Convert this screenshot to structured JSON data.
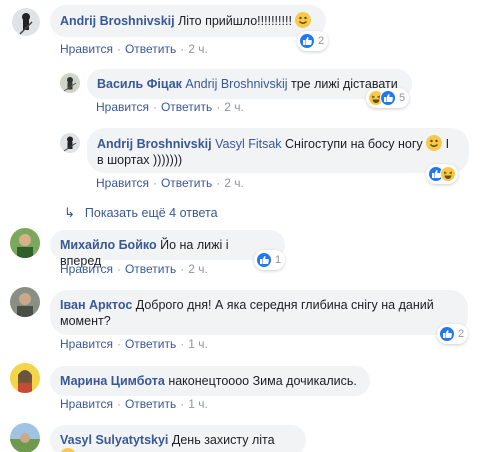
{
  "actions": {
    "like": "Нравится",
    "reply": "Ответить",
    "sep": "·"
  },
  "comments": [
    {
      "author": "Andrij Broshnivskij",
      "text": "Літо прийшло!!!!!!!!!!",
      "time": "2 ч.",
      "reactions": "2"
    },
    {
      "author": "Василь Фіцак",
      "mention": "Andrij Broshnivskij",
      "text": "тре лижі діставати",
      "time": "2 ч.",
      "reactions": "5"
    },
    {
      "author": "Andrij Broshnivskij",
      "mention": "Vasyl Fitsak",
      "text_line1": "Снігоступи на босу ногу",
      "text_suffix": "І",
      "text_line2": "в шортах )))))))",
      "time": "2 ч."
    },
    {
      "author": "Михайло Бойко",
      "text": "Йо на лижі і вперед",
      "time": "2 ч.",
      "reactions": "1"
    },
    {
      "author": "Іван Арктос",
      "text_line1": "Доброго дня! А яка середня глибина снігу на даний",
      "text_line2": "момент?",
      "time": "1 ч.",
      "reactions": "2"
    },
    {
      "author": "Марина Цимбота",
      "text": "наконецтоооо Зима дочикались.",
      "time": "1 ч."
    },
    {
      "author": "Vasyl Sulyatytskyi",
      "text": "День захисту літа"
    }
  ],
  "more_replies": "Показать ещё 4 ответа",
  "icons": {
    "like": "like-icon",
    "haha": "haha-icon",
    "smile": "smile-emoji-icon",
    "laugh": "laugh-emoji-icon",
    "reply_arrow": "reply-arrow-icon"
  },
  "colors": {
    "link": "#385898",
    "meta": "#90949c",
    "bubble": "#f2f3f5",
    "like": "#2078f4"
  }
}
